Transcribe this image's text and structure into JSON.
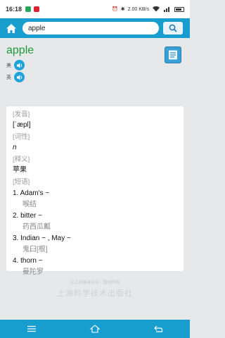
{
  "statusbar": {
    "time": "16:18",
    "net_speed": "2.00 KB/s"
  },
  "search": {
    "query": "apple"
  },
  "entry": {
    "headword": "apple",
    "pron_us_label": "美",
    "pron_uk_label": "英"
  },
  "card": {
    "phonetic_label": "[发音]",
    "phonetic": "[ˈæpl]",
    "pos_label": "[词性]",
    "pos": "n",
    "definition_label": "[释义]",
    "definition": "苹果",
    "phrases_label": "[短语]",
    "phrases": [
      {
        "text": "1. Adam's ~",
        "translation": "喉结"
      },
      {
        "text": "2. bitter ~",
        "translation": "药西瓜瓤"
      },
      {
        "text": "3. Indian ~ , May ~",
        "translation": "鬼臼[根]"
      },
      {
        "text": "4. thorn ~",
        "translation": "曼陀罗"
      }
    ]
  },
  "watermark": {
    "small": "以上内容来自于 · 版权所有",
    "big": "上海科学技术出版社"
  }
}
